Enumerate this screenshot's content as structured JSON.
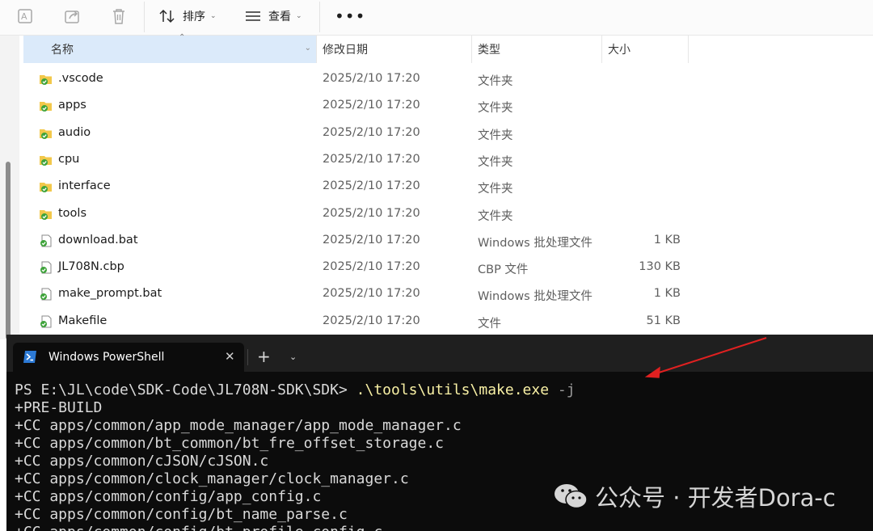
{
  "toolbar": {
    "sort_label": "排序",
    "view_label": "查看"
  },
  "columns": {
    "name": "名称",
    "date": "修改日期",
    "type": "类型",
    "size": "大小"
  },
  "files": [
    {
      "name": ".vscode",
      "date": "2025/2/10 17:20",
      "type": "文件夹",
      "size": "",
      "icon": "folder-icon"
    },
    {
      "name": "apps",
      "date": "2025/2/10 17:20",
      "type": "文件夹",
      "size": "",
      "icon": "folder-icon"
    },
    {
      "name": "audio",
      "date": "2025/2/10 17:20",
      "type": "文件夹",
      "size": "",
      "icon": "folder-icon"
    },
    {
      "name": "cpu",
      "date": "2025/2/10 17:20",
      "type": "文件夹",
      "size": "",
      "icon": "folder-icon"
    },
    {
      "name": "interface",
      "date": "2025/2/10 17:20",
      "type": "文件夹",
      "size": "",
      "icon": "folder-icon"
    },
    {
      "name": "tools",
      "date": "2025/2/10 17:20",
      "type": "文件夹",
      "size": "",
      "icon": "folder-icon"
    },
    {
      "name": "download.bat",
      "date": "2025/2/10 17:20",
      "type": "Windows 批处理文件",
      "size": "1 KB",
      "icon": "batch-file-icon"
    },
    {
      "name": "JL708N.cbp",
      "date": "2025/2/10 17:20",
      "type": "CBP 文件",
      "size": "130 KB",
      "icon": "file-icon"
    },
    {
      "name": "make_prompt.bat",
      "date": "2025/2/10 17:20",
      "type": "Windows 批处理文件",
      "size": "1 KB",
      "icon": "batch-file-icon"
    },
    {
      "name": "Makefile",
      "date": "2025/2/10 17:20",
      "type": "文件",
      "size": "51 KB",
      "icon": "file-icon"
    }
  ],
  "terminal": {
    "tab_title": "Windows PowerShell",
    "prompt": "PS E:\\JL\\code\\SDK-Code\\JL708N-SDK\\SDK> ",
    "command": ".\\tools\\utils\\make.exe",
    "flag": " -j",
    "output": [
      "+PRE-BUILD",
      "+CC apps/common/app_mode_manager/app_mode_manager.c",
      "+CC apps/common/bt_common/bt_fre_offset_storage.c",
      "+CC apps/common/cJSON/cJSON.c",
      "+CC apps/common/clock_manager/clock_manager.c",
      "+CC apps/common/config/app_config.c",
      "+CC apps/common/config/bt_name_parse.c",
      "+CC apps/common/config/bt_profile_config.c"
    ]
  },
  "watermark": {
    "text": "公众号 · 开发者Dora-c"
  },
  "colors": {
    "selected_header": "#dbeafa",
    "terminal_bg": "#0c0c0c",
    "command": "#f9f1a5",
    "arrow": "#e02020"
  }
}
